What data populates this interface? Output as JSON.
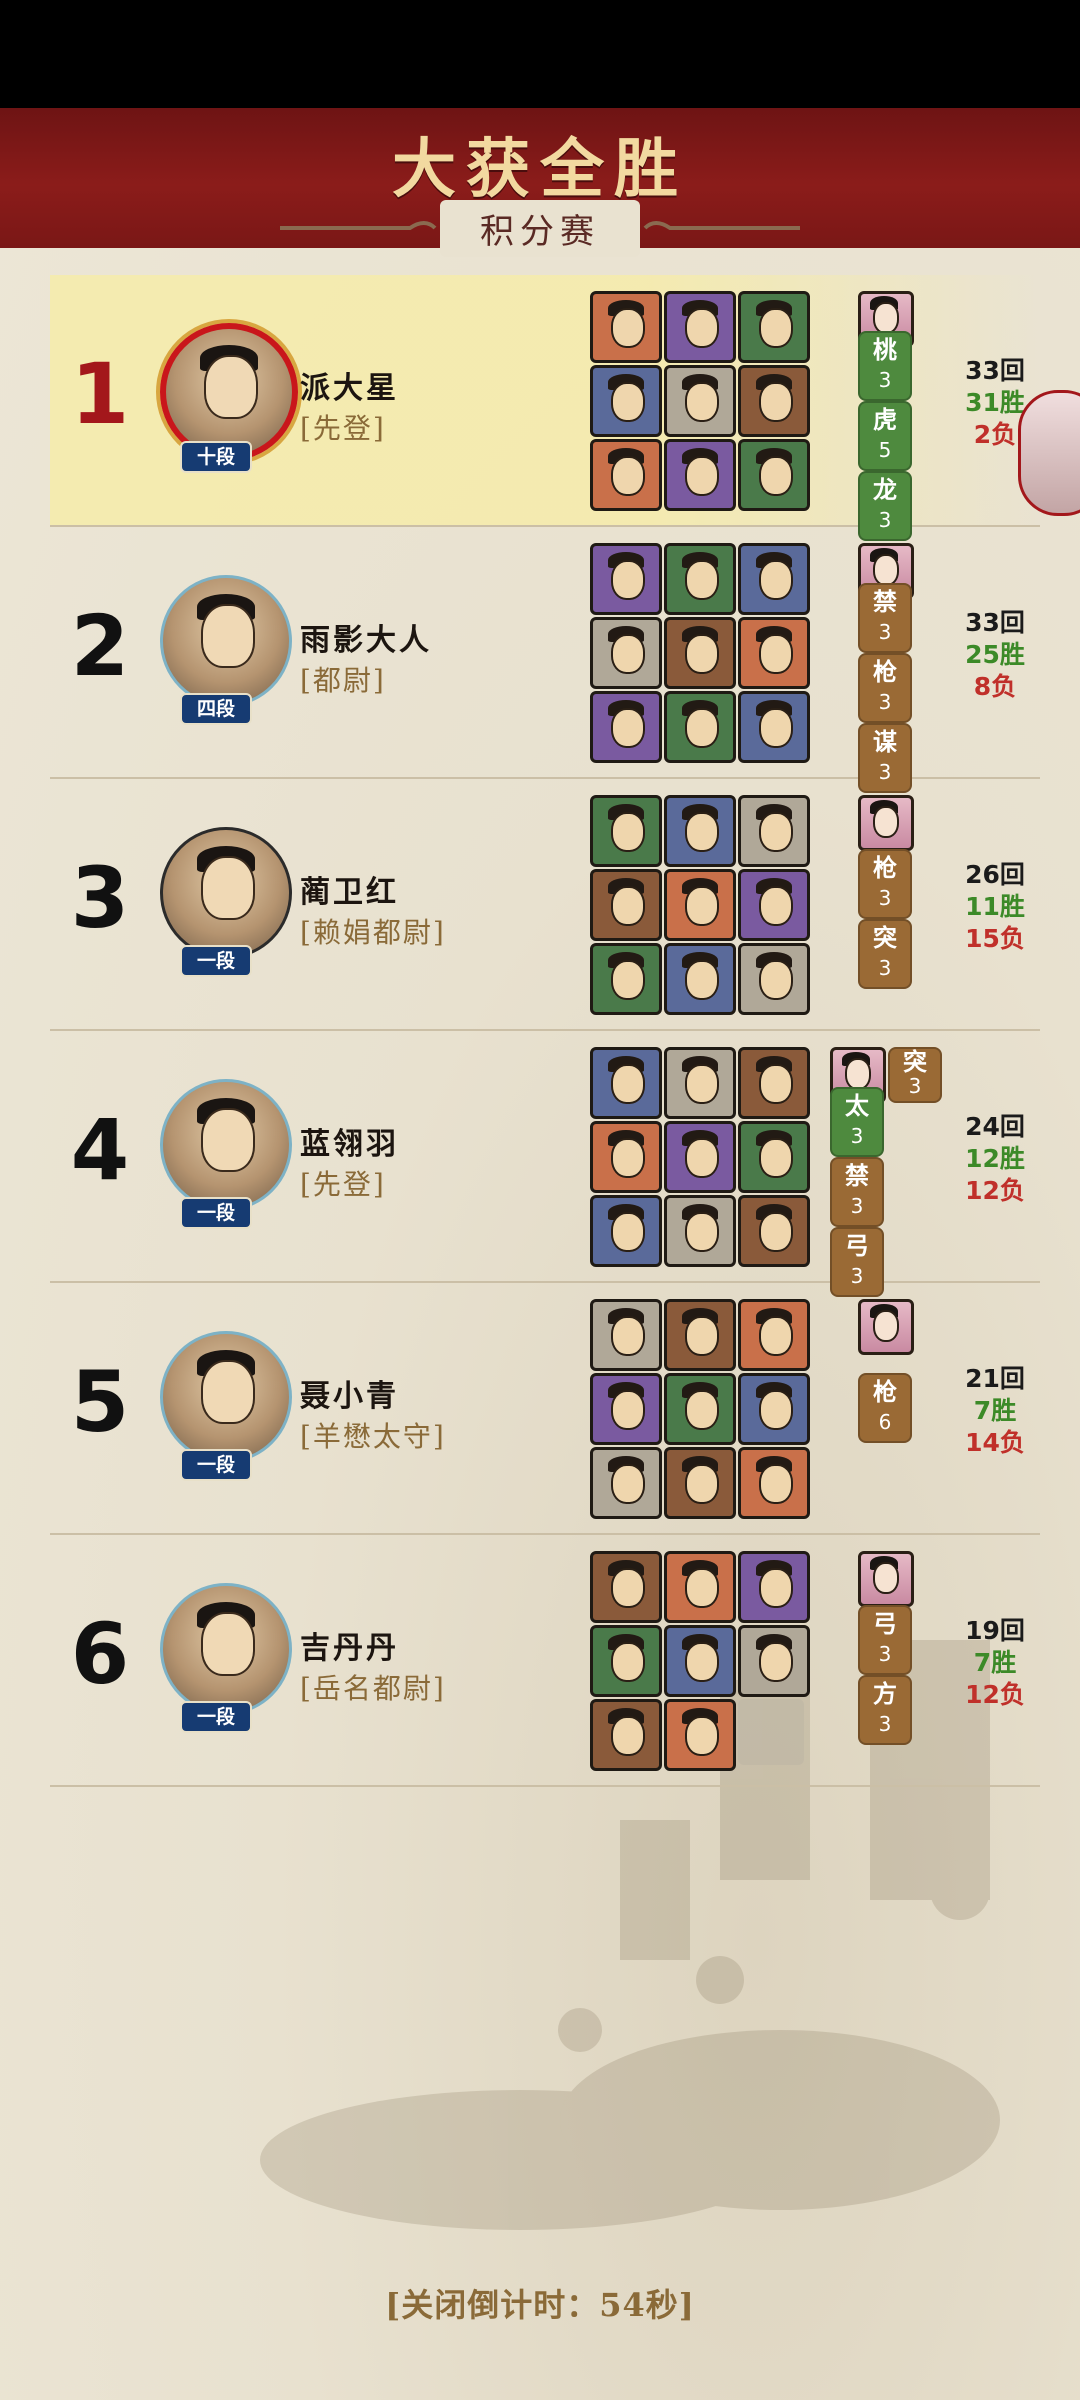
{
  "header": {
    "title": "大获全胜",
    "subtitle": "积分赛"
  },
  "colors": {
    "banner": "#8b1c1a",
    "title": "#f2d9a0",
    "win": "#3c8a28",
    "loss": "#c0302a",
    "rank_title": "#8a6a38",
    "dan_badge": "#163b72"
  },
  "players": [
    {
      "rank": "1",
      "name": "派大星",
      "title": "[先登]",
      "dan": "十段",
      "rounds": "33回",
      "wins": "31胜",
      "losses": "2负",
      "tags": [
        {
          "t": "桃",
          "n": "3",
          "c": "green"
        },
        {
          "t": "虎",
          "n": "5",
          "c": "green"
        },
        {
          "t": "龙",
          "n": "3",
          "c": "green"
        }
      ]
    },
    {
      "rank": "2",
      "name": "雨影大人",
      "title": "[都尉]",
      "dan": "四段",
      "rounds": "33回",
      "wins": "25胜",
      "losses": "8负",
      "tags": [
        {
          "t": "禁",
          "n": "3",
          "c": "brown"
        },
        {
          "t": "枪",
          "n": "3",
          "c": "brown"
        },
        {
          "t": "谋",
          "n": "3",
          "c": "brown"
        }
      ]
    },
    {
      "rank": "3",
      "name": "蔺卫红",
      "title": "[赖娟都尉]",
      "dan": "一段",
      "rounds": "26回",
      "wins": "11胜",
      "losses": "15负",
      "tags": [
        {
          "t": "枪",
          "n": "3",
          "c": "brown"
        },
        {
          "t": "突",
          "n": "3",
          "c": "brown"
        }
      ]
    },
    {
      "rank": "4",
      "name": "蓝翎羽",
      "title": "[先登]",
      "dan": "一段",
      "rounds": "24回",
      "wins": "12胜",
      "losses": "12负",
      "tags": [
        {
          "t": "太",
          "n": "3",
          "c": "green"
        },
        {
          "t": "禁",
          "n": "3",
          "c": "brown"
        },
        {
          "t": "弓",
          "n": "3",
          "c": "brown"
        }
      ],
      "extra_tag": {
        "t": "突",
        "n": "3",
        "c": "brown"
      }
    },
    {
      "rank": "5",
      "name": "聂小青",
      "title": "[羊懋太守]",
      "dan": "一段",
      "rounds": "21回",
      "wins": "7胜",
      "losses": "14负",
      "tags": [
        {
          "t": "枪",
          "n": "6",
          "c": "brown"
        }
      ]
    },
    {
      "rank": "6",
      "name": "吉丹丹",
      "title": "[岳名都尉]",
      "dan": "一段",
      "rounds": "19回",
      "wins": "7胜",
      "losses": "12负",
      "tags": [
        {
          "t": "弓",
          "n": "3",
          "c": "brown"
        },
        {
          "t": "方",
          "n": "3",
          "c": "brown"
        }
      ]
    }
  ],
  "footer": {
    "countdown": "[关闭倒计时：54秒]"
  }
}
